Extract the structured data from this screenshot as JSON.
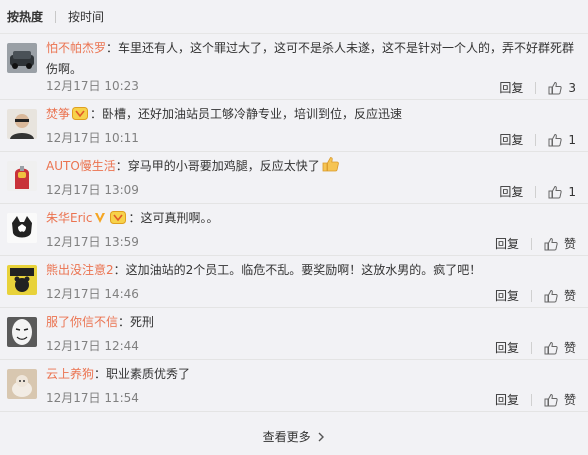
{
  "tabs": {
    "hot": "按热度",
    "time": "按时间"
  },
  "comments": [
    {
      "user": "怕不帕杰罗",
      "badge": false,
      "text": "：车里还有人，这个罪过大了，这可不是杀人未遂，这不是针对一个人的，弄不好群死群伤啊。",
      "time": "12月17日 10:23",
      "reply": "回复",
      "likes": "3"
    },
    {
      "user": "焚筝",
      "badge": true,
      "text": "：卧槽，还好加油站员工够冷静专业，培训到位，反应迅速",
      "time": "12月17日 10:11",
      "reply": "回复",
      "likes": "1"
    },
    {
      "user": "AUTO慢生活",
      "badge": false,
      "text": "：穿马甲的小哥要加鸡腿，反应太快了",
      "time": "12月17日 13:09",
      "reply": "回复",
      "likes": "1"
    },
    {
      "user": "朱华Eric",
      "badge": true,
      "text": "：这可真刑啊。。",
      "time": "12月17日 13:59",
      "reply": "回复",
      "likes": "赞"
    },
    {
      "user": "熊出没注意2",
      "badge": false,
      "text": "：这加油站的2个员工。临危不乱。要奖励啊！这放水男的。疯了吧！",
      "time": "12月17日 14:46",
      "reply": "回复",
      "likes": "赞"
    },
    {
      "user": "服了你信不信",
      "badge": false,
      "text": "：死刑",
      "time": "12月17日 12:44",
      "reply": "回复",
      "likes": "赞"
    },
    {
      "user": "云上养狗",
      "badge": false,
      "text": "：职业素质优秀了",
      "time": "12月17日 11:54",
      "reply": "回复",
      "likes": "赞"
    }
  ],
  "more": "查看更多",
  "colors": {
    "username": "#eb7350",
    "meta": "#808080",
    "background": "#f2f2f5"
  },
  "icons": {
    "like": "thumbs-up-icon",
    "more": "chevron-right-icon",
    "badge": "member-badge-icon",
    "v": "verified-v-icon",
    "emoji": "thumbs-up-emoji"
  }
}
